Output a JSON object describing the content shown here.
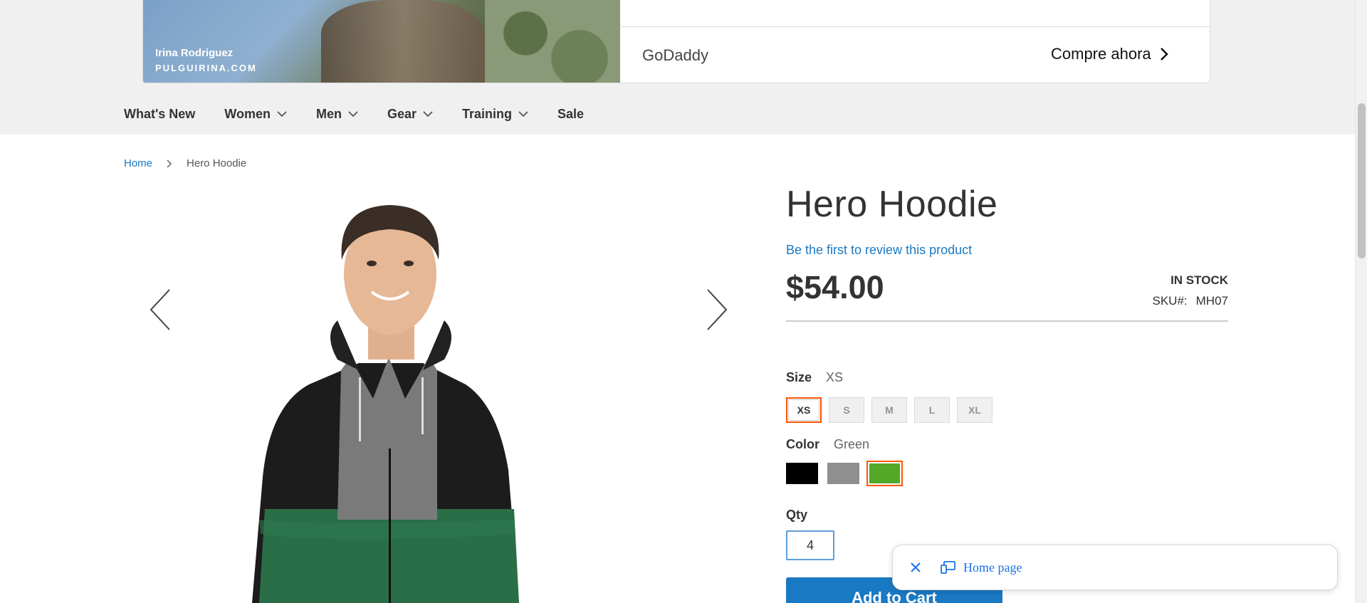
{
  "ad": {
    "photo_credit_name": "Irina Rodriguez",
    "photo_credit_site": "PULGUIRINA.COM",
    "brand": "GoDaddy",
    "cta": "Compre ahora"
  },
  "nav": {
    "items": [
      {
        "label": "What's New",
        "has_dropdown": false
      },
      {
        "label": "Women",
        "has_dropdown": true
      },
      {
        "label": "Men",
        "has_dropdown": true
      },
      {
        "label": "Gear",
        "has_dropdown": true
      },
      {
        "label": "Training",
        "has_dropdown": true
      },
      {
        "label": "Sale",
        "has_dropdown": false
      }
    ]
  },
  "breadcrumb": {
    "home": "Home",
    "current": "Hero Hoodie"
  },
  "product": {
    "title": "Hero Hoodie",
    "review_link": "Be the first to review this product",
    "price": "$54.00",
    "stock": "IN STOCK",
    "sku_label": "SKU#:",
    "sku": "MH07",
    "size": {
      "label": "Size",
      "selected": "XS",
      "options": [
        "XS",
        "S",
        "M",
        "L",
        "XL"
      ]
    },
    "color": {
      "label": "Color",
      "selected": "Green",
      "options": [
        {
          "name": "Black",
          "hex": "#000000"
        },
        {
          "name": "Gray",
          "hex": "#8f8f8f"
        },
        {
          "name": "Green",
          "hex": "#53a828"
        }
      ]
    },
    "qty": {
      "label": "Qty",
      "value": "4"
    },
    "add_to_cart": "Add to Cart"
  },
  "popup": {
    "link": "Home page"
  },
  "colors": {
    "accent": "#1979c3",
    "selected_border": "#ff5501",
    "link": "#1a73e8"
  }
}
